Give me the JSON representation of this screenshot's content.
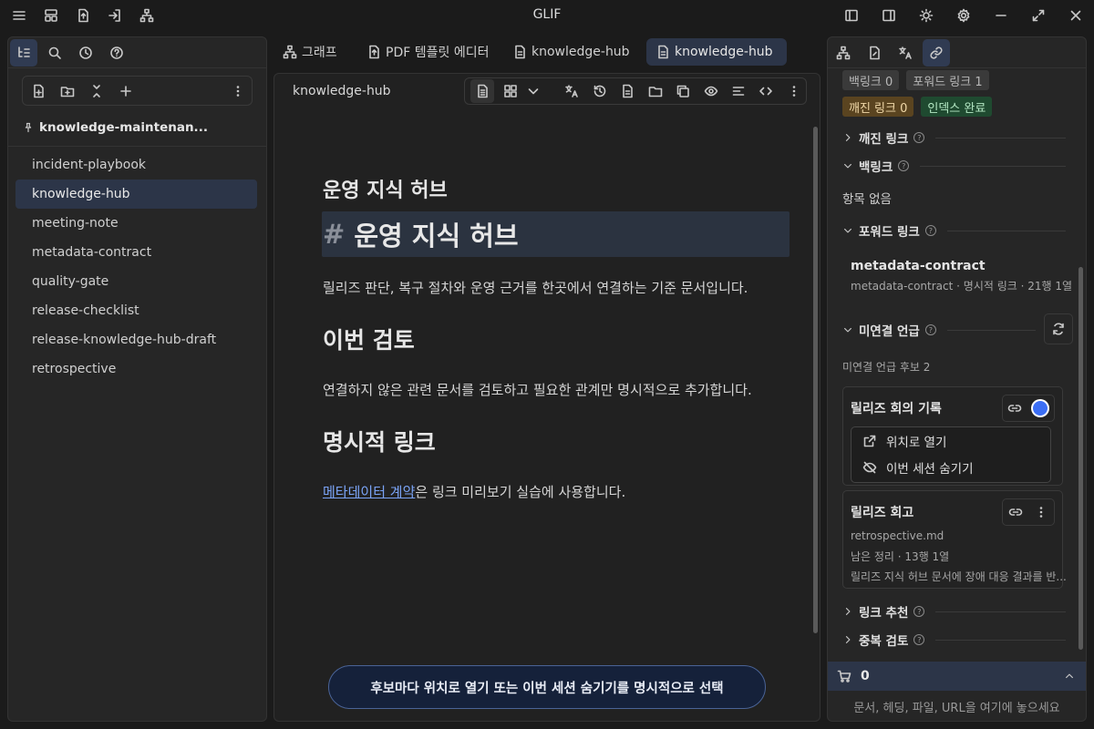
{
  "app": {
    "title": "GLIF"
  },
  "vault": {
    "name": "knowledge-maintenan..."
  },
  "files": [
    "incident-playbook",
    "knowledge-hub",
    "meeting-note",
    "metadata-contract",
    "quality-gate",
    "release-checklist",
    "release-knowledge-hub-draft",
    "retrospective"
  ],
  "selected_file": "knowledge-hub",
  "tabs": [
    {
      "label": "그래프",
      "icon": "graph-icon"
    },
    {
      "label": "PDF 템플릿 에디터",
      "icon": "pdf-template-icon"
    },
    {
      "label": "knowledge-hub",
      "icon": "document-icon"
    },
    {
      "label": "knowledge-hub",
      "icon": "document-icon",
      "active": true
    }
  ],
  "editor": {
    "breadcrumb": "knowledge-hub",
    "heading_rendered": "운영 지식 허브",
    "hash": "#",
    "heading_source": "운영 지식 허브",
    "para1": "릴리즈 판단, 복구 절차와 운영 근거를 한곳에서 연결하는 기준 문서입니다.",
    "h2_review": "이번 검토",
    "para2": "연결하지 않은 관련 문서를 검토하고 필요한 관계만 명시적으로 추가합니다.",
    "h2_links": "명시적 링크",
    "link_text": "메타데이터 계약",
    "para3_rest": "은 링크 미리보기 실습에 사용합니다."
  },
  "banner": "후보마다 위치로 열기 또는 이번 세션 숨기기를 명시적으로 선택",
  "right": {
    "badges": {
      "backlinks": "백링크 0",
      "forward": "포워드 링크 1",
      "broken": "깨진 링크 0",
      "indexed": "인덱스 완료"
    },
    "sec_broken": "깨진 링크",
    "sec_backlinks": "백링크",
    "no_items": "항목 없음",
    "sec_forward": "포워드 링크",
    "forward_item": {
      "title": "metadata-contract",
      "meta": "metadata-contract · 명시적 링크 · 21행 1열"
    },
    "sec_unlinked": "미연결 언급",
    "unlinked_count": "미연결 언급 후보 2",
    "card1": {
      "title": "릴리즈 회의 기록",
      "menu_open": "위치로 열기",
      "menu_hide": "이번 세션 숨기기"
    },
    "card2": {
      "title": "릴리즈 회고",
      "file": "retrospective.md",
      "meta": "남은 정리 · 13행 1열",
      "snippet": "릴리즈 지식 허브 문서에 장애 대응 결과를 반..."
    },
    "sec_suggest": "링크 추천",
    "sec_dup": "중복 검토",
    "cart_count": "0",
    "drop_hint": "문서, 헤딩, 파일, URL을 여기에 놓으세요",
    "help_glyph": "?"
  },
  "colors": {
    "accent": "#2c3548",
    "link": "#7aa3f5",
    "toggle": "#3b6ef5"
  }
}
